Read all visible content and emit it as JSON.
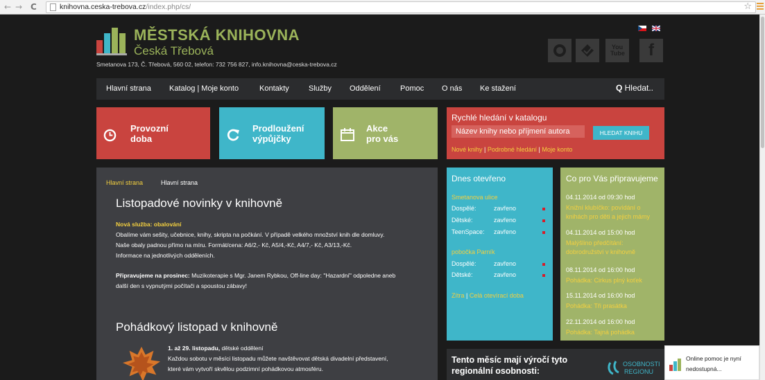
{
  "browser": {
    "url_host": "knihovna.ceska-trebova.cz",
    "url_path": "/index.php/cs/"
  },
  "header": {
    "title": "MĚSTSKÁ KNIHOVNA",
    "subtitle": "Česká Třebová",
    "address": "Smetanova 173, Č. Třebová, 560 02, telefon: 732 756 827, info.knihovna@ceska-trebova.cz",
    "social": [
      "globe-icon",
      "bookmark-icon",
      "youtube-icon",
      "facebook-icon"
    ],
    "youtube_label": "You Tube",
    "facebook_label": "f"
  },
  "nav": {
    "items": [
      "Hlavní strana",
      "Katalog | Moje konto",
      "Kontakty",
      "Služby",
      "Oddělení",
      "Pomoc",
      "O nás",
      "Ke stažení"
    ],
    "search": "Hledat.."
  },
  "tiles": [
    {
      "label1": "Provozní",
      "label2": "doba",
      "color": "#c9443f",
      "icon": "clock-icon"
    },
    {
      "label1": "Prodloužení",
      "label2": "výpůjčky",
      "color": "#3fb6c9",
      "icon": "refresh-icon"
    },
    {
      "label1": "Akce",
      "label2": "pro vás",
      "color": "#a0b469",
      "icon": "calendar-icon"
    }
  ],
  "quick_search": {
    "title": "Rychlé hledání v katalogu",
    "placeholder": "Název knihy nebo příjmení autora",
    "button": "HLEDAT KNIHU",
    "link1": "Nové knihy",
    "sep": "|",
    "link2": "Podrobné hledání",
    "link3": "Moje konto"
  },
  "main": {
    "breadcrumb_link": "Hlavní strana",
    "breadcrumb_current": "Hlavní strana",
    "article1": {
      "title": "Listopadové novinky v knihovně",
      "highlight": "Nová služba: obalování",
      "line1": "Obalíme vám sešity, učebnice, knihy, skripta na počkání. V případě velkého množství knih dle domluvy.",
      "line2": "Naše obaly padnou přímo na míru. Formát/cena: A6/2,- Kč, A5/4,-Kč, A4/7,- Kč, A3/13,-Kč.",
      "line3": "Informace na jednotlivých odděleních.",
      "prep_bold": "Připravujeme na prosinec:",
      "prep_text": " Muzikoterapie s Mgr. Janem Rybkou, Off-line day: \"Hazardní\" odpoledne aneb",
      "prep_text2": "další den s vypnutými počítači a spoustou zábavy!"
    },
    "article2": {
      "title": "Pohádkový listopad v knihovně",
      "date_bold": "1. až 29. listopadu,",
      "date_rest": " dětské oddělení",
      "line1": "Každou sobotu v měsíci listopadu můžete navštěvovat dětská divadelní představení,",
      "line2": "které vám vytvoří skvělou podzimní pohádkovou atmosféru."
    }
  },
  "today_open": {
    "title": "Dnes otevřeno",
    "section1": "Smetanova ulice",
    "rows1": [
      {
        "name": "Dospělé:",
        "status": "zavřeno"
      },
      {
        "name": "Dětské:",
        "status": "zavřeno"
      },
      {
        "name": "TeenSpace:",
        "status": "zavřeno"
      }
    ],
    "section2": "pobočka Parník",
    "rows2": [
      {
        "name": "Dospělé:",
        "status": "zavřeno"
      },
      {
        "name": "Dětské:",
        "status": "zavřeno"
      }
    ],
    "link1": "Zítra",
    "sep": "|",
    "link2": "Celá otevírací doba"
  },
  "prepare": {
    "title": "Co pro Vás připravujeme",
    "events": [
      {
        "date": "04.11.2014 od 09:30 hod",
        "line1": "Knižní klubíčko: povídání o",
        "line2": "knihách pro děti a jejich mámy"
      },
      {
        "date": "04.11.2014 od 15:00 hod",
        "line1": "Malýšlino předčítání:",
        "line2": "dobrodružství v knihovně"
      },
      {
        "date": "08.11.2014 od 16:00 hod",
        "line1": "Pohádka: Cirkus plný koťek",
        "line2": ""
      },
      {
        "date": "15.11.2014 od 16:00 hod",
        "line1": "Pohádka: Tři prasátka",
        "line2": ""
      },
      {
        "date": "22.11.2014 od 16:00 hod",
        "line1": "Pohádka: Tajná pohádka",
        "line2": ""
      }
    ]
  },
  "anniversaries": {
    "line1": "Tento měsíc mají výročí tyto",
    "line2": "regionální osobnosti:",
    "logo1": "OSOBNOSTI",
    "logo2": "REGIONU"
  },
  "chat": {
    "line1": "Online pomoc je nyní",
    "line2": "nedostupná..."
  },
  "colors": {
    "green": "#9bb35a",
    "red": "#c9443f",
    "cyan": "#3fb6c9",
    "olive": "#a0b469",
    "yellow": "#f4d03f"
  }
}
